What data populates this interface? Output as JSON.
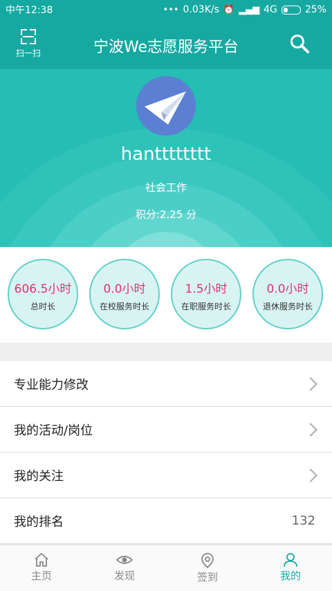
{
  "status": {
    "time": "中午12:38",
    "speed": "0.03K/s",
    "network": "4G",
    "battery": "25%"
  },
  "header": {
    "scan_label": "扫一扫",
    "title": "宁波We志愿服务平台"
  },
  "profile": {
    "username": "hantttttttt",
    "role": "社会工作",
    "points": "积分:2.25 分"
  },
  "stats": [
    {
      "value": "606.5小时",
      "label": "总时长"
    },
    {
      "value": "0.0小时",
      "label": "在校服务时长"
    },
    {
      "value": "1.5小时",
      "label": "在职服务时长"
    },
    {
      "value": "0.0小时",
      "label": "退休服务时长"
    }
  ],
  "menu": [
    {
      "label": "专业能力修改"
    },
    {
      "label": "我的活动/岗位"
    },
    {
      "label": "我的关注"
    },
    {
      "label": "我的排名",
      "value": "132"
    }
  ],
  "tabs": [
    {
      "label": "主页",
      "icon": "home-icon"
    },
    {
      "label": "发现",
      "icon": "eye-icon"
    },
    {
      "label": "签到",
      "icon": "location-pin-icon"
    },
    {
      "label": "我的",
      "icon": "user-icon",
      "active": true
    }
  ],
  "colors": {
    "primary": "#16a9a2",
    "hero": "#25bdb4",
    "stat_value": "#e0336b",
    "stat_circle": "#d8f4f2"
  }
}
